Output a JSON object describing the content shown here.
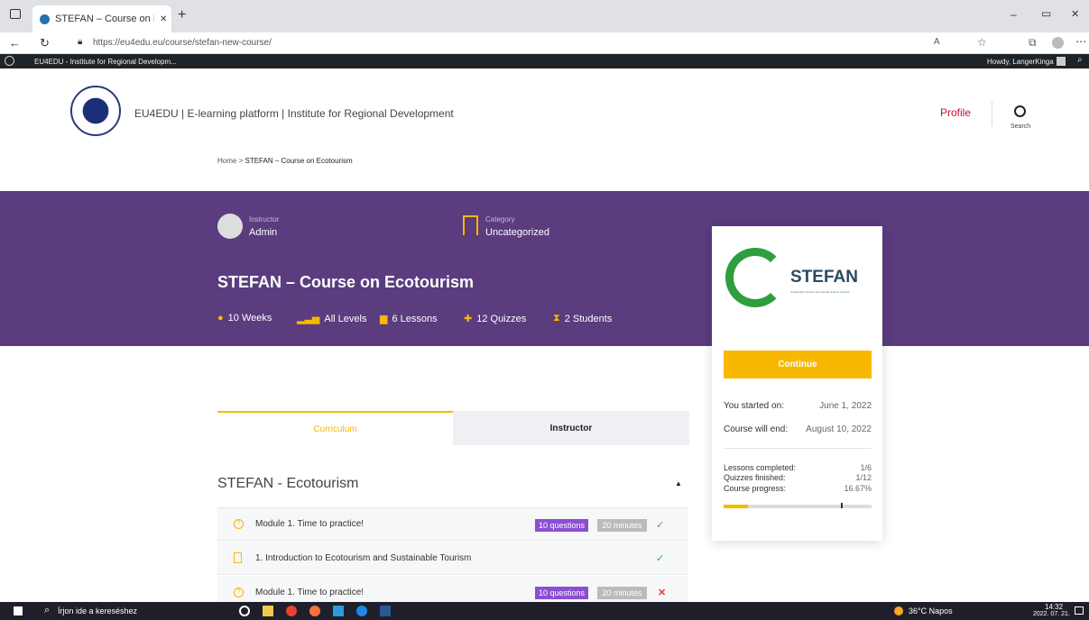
{
  "browser": {
    "tab_title": "STEFAN – Course on Ecotourism",
    "url": "https://eu4edu.eu/course/stefan-new-course/",
    "new_tab": "+",
    "min": "–",
    "restore": "▭",
    "close": "✕"
  },
  "wp_admin": {
    "site_name": "EU4EDU - Institute for Regional Developm...",
    "howdy": "Howdy, LangerKinga"
  },
  "header": {
    "site_title": "EU4EDU | E-learning platform | Institute for Regional Development",
    "profile": "Profile",
    "search": "Search"
  },
  "breadcrumb": {
    "home": "Home",
    "sep": ">",
    "current": "STEFAN – Course on Ecotourism"
  },
  "hero": {
    "instructor_label": "Instructor",
    "instructor_name": "Admin",
    "category_label": "Category",
    "category_name": "Uncategorized",
    "title": "STEFAN – Course on Ecotourism",
    "stats": {
      "duration": "10 Weeks",
      "levels": "All Levels",
      "lessons": "6 Lessons",
      "quizzes": "12 Quizzes",
      "students": "2 Students"
    }
  },
  "card": {
    "logo_text": "STEFAN",
    "logo_sub": "Sustainable Tourism Eco-friendly Actions Network",
    "continue": "Continue",
    "started_label": "You started on:",
    "started_value": "June 1, 2022",
    "end_label": "Course will end:",
    "end_value": "August 10, 2022",
    "lessons_label": "Lessons completed:",
    "lessons_value": "1/6",
    "quizzes_label": "Quizzes finished:",
    "quizzes_value": "1/12",
    "progress_label": "Course progress:",
    "progress_value": "16.67%",
    "progress_fraction": 0.1667,
    "accent": "#f9b800"
  },
  "tabs": {
    "curriculum": "Curriculum",
    "instructor": "Instructor"
  },
  "curriculum": {
    "section_title": "STEFAN - Ecotourism",
    "items": [
      {
        "title": "Module 1. Time to practice!",
        "questions": "10 questions",
        "duration": "20 minutes",
        "status": "✓"
      },
      {
        "title": "1. Introduction to Ecotourism and Sustainable Tourism",
        "status": "✓"
      },
      {
        "title": "Module 1. Time to practice!",
        "questions": "10 questions",
        "duration": "20 minutes",
        "status": "✕"
      }
    ]
  },
  "taskbar": {
    "search": "Írjon ide a kereséshez",
    "weather": "36°C  Napos",
    "time": "14:32",
    "date": "2022. 07. 21."
  },
  "colors": {
    "purple": "#5a3c7f",
    "yellow": "#f9b800",
    "badge_purple": "#8a4fd1",
    "badge_gray": "#bbbbbb",
    "check_green": "#3ba84a",
    "cross_red": "#e53935"
  }
}
